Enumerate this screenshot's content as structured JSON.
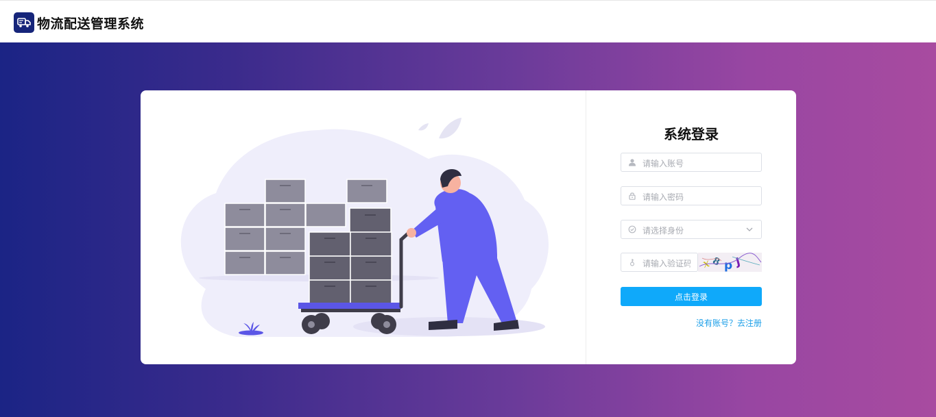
{
  "header": {
    "app_title": "物流配送管理系统",
    "logo_icon": "truck-icon"
  },
  "colors": {
    "brand_dark": "#16257a",
    "gradient_start": "#1b2485",
    "gradient_end": "#a84ba0",
    "primary_button": "#0fa9fa",
    "link": "#1a9ee8"
  },
  "login": {
    "title": "系统登录",
    "username": {
      "placeholder": "请输入账号",
      "icon": "user-icon"
    },
    "password": {
      "placeholder": "请输入密码",
      "icon": "lock-icon"
    },
    "role": {
      "placeholder": "请选择身份",
      "icon": "check-circle-icon",
      "dropdown_icon": "chevron-down-icon"
    },
    "captcha": {
      "placeholder": "请输入验证码",
      "icon": "key-icon",
      "image_text": "x8pJ"
    },
    "submit_label": "点击登录",
    "register_link": "没有账号？去注册"
  }
}
